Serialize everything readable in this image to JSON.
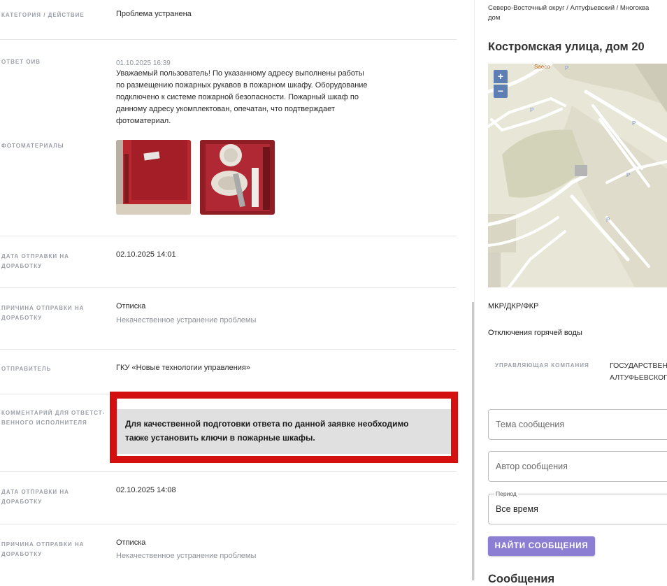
{
  "left": {
    "category": {
      "label": "КАТЕГОРИЯ / ДЕЙСТВИЕ",
      "value": "Проблема устранена"
    },
    "oiv": {
      "label": "ОТВЕТ ОИВ",
      "timestamp": "01.10.2025 16:39",
      "lines": [
        "Уважаемый пользователь! По указанному адресу выполнены работы",
        "по размещению пожарных рукавов в пожарном шкафу. Оборудование",
        "подключено к системе пожарной безопасности. Пожарный шкаф по",
        "данному адресу укомплектован, опечатан, что подтверждает",
        "фотоматериал."
      ]
    },
    "photos": {
      "label": "ФОТОМАТЕРИАЛЫ"
    },
    "send1": {
      "label_1": "ДАТА ОТПРАВКИ НА",
      "label_2": "ДОРАБОТКУ",
      "value": "02.10.2025 14:01"
    },
    "reason1": {
      "label_1": "ПРИЧИНА ОТПРАВКИ НА",
      "label_2": "ДОРАБОТКУ",
      "value": "Отписка",
      "sub": "Некачественное устранение проблемы"
    },
    "sender": {
      "label": "ОТПРАВИТЕЛЬ",
      "value": "ГКУ «Новые технологии управления»"
    },
    "comment": {
      "label_1": "КОММЕНТАРИЙ ДЛЯ ОТВЕТСТ-",
      "label_2": "ВЕННОГО ИСПОЛНИТЕЛЯ",
      "line_1": "Для качественной подготовки ответа по данной заявке необходимо",
      "line_2": "также установить ключи в пожарные шкафы."
    },
    "send2": {
      "label_1": "ДАТА ОТПРАВКИ НА",
      "label_2": "ДОРАБОТКУ",
      "value": "02.10.2025 14:08"
    },
    "reason2": {
      "label_1": "ПРИЧИНА ОТПРАВКИ НА",
      "label_2": "ДОРАБОТКУ",
      "value": "Отписка",
      "sub": "Некачественное устранение проблемы"
    }
  },
  "right": {
    "breadcrumb_1": "Северо-Восточный округ / Алтуфьевский / Многоква",
    "breadcrumb_2": "дом",
    "address": "Костромская улица, дом 20",
    "map": {
      "zoom_in": "+",
      "zoom_out": "−",
      "poi": "Saeco",
      "parking": "P"
    },
    "type": "МКР/ДКР/ФКР",
    "subtype": "Отключения горячей воды",
    "company": {
      "label": "УПРАВЛЯЮЩАЯ КОМПАНИЯ",
      "value_1": "ГОСУДАРСТВЕН",
      "value_2": "АЛТУФЬЕВСКОГ"
    },
    "topic_placeholder": "Тема сообщения",
    "author_placeholder": "Автор сообщения",
    "period": {
      "legend": "Период",
      "value": "Все время"
    },
    "search_button": "НАЙТИ СООБЩЕНИЯ",
    "messages_heading": "Сообщения"
  },
  "colors": {
    "highlight": "#d40f0f",
    "button": "#8c7fd3",
    "map_bg": "#e7e6d6"
  }
}
